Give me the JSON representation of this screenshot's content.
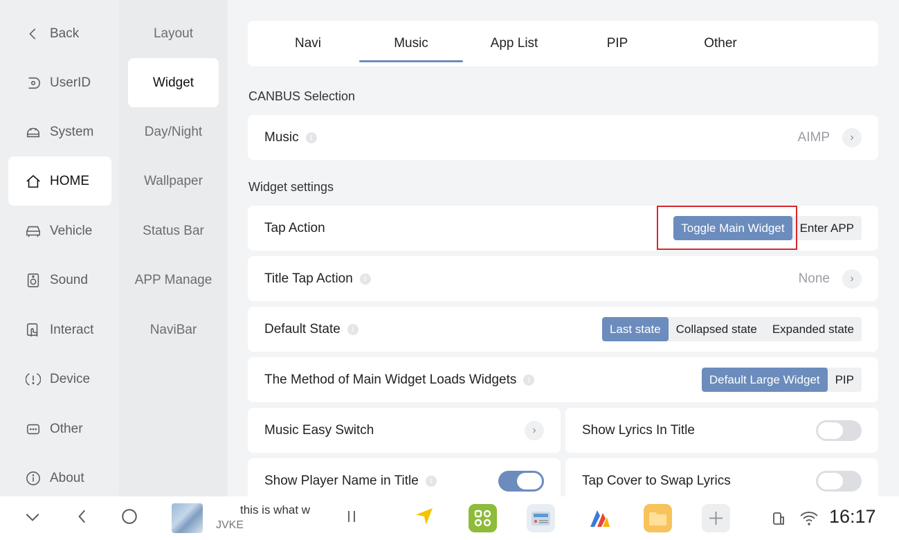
{
  "nav1": {
    "items": [
      {
        "label": "Back",
        "icon": "chevron-left-icon"
      },
      {
        "label": "UserID",
        "icon": "user-id-icon"
      },
      {
        "label": "System",
        "icon": "android-icon"
      },
      {
        "label": "HOME",
        "icon": "home-icon"
      },
      {
        "label": "Vehicle",
        "icon": "car-icon"
      },
      {
        "label": "Sound",
        "icon": "speaker-icon"
      },
      {
        "label": "Interact",
        "icon": "touch-icon"
      },
      {
        "label": "Device",
        "icon": "alert-icon"
      },
      {
        "label": "Other",
        "icon": "more-icon"
      },
      {
        "label": "About",
        "icon": "info-icon"
      }
    ],
    "active": "HOME"
  },
  "nav2": {
    "items": [
      "Layout",
      "Widget",
      "Day/Night",
      "Wallpaper",
      "Status Bar",
      "APP Manage",
      "NaviBar"
    ],
    "active": "Widget"
  },
  "tabs": {
    "items": [
      "Navi",
      "Music",
      "App List",
      "PIP",
      "Other"
    ],
    "active": "Music"
  },
  "canbus": {
    "title": "CANBUS Selection",
    "music_label": "Music",
    "music_value": "AIMP"
  },
  "widget_settings": {
    "title": "Widget settings",
    "tap_action": {
      "label": "Tap Action",
      "options": [
        "Toggle Main Widget",
        "Enter APP"
      ],
      "selected": "Toggle Main Widget"
    },
    "title_tap_action": {
      "label": "Title Tap Action",
      "value": "None"
    },
    "default_state": {
      "label": "Default State",
      "options": [
        "Last state",
        "Collapsed state",
        "Expanded state"
      ],
      "selected": "Last state"
    },
    "load_method": {
      "label": "The Method of Main Widget Loads Widgets",
      "options": [
        "Default Large Widget",
        "PIP"
      ],
      "selected": "Default Large Widget"
    },
    "music_easy_switch": {
      "label": "Music Easy Switch"
    },
    "show_lyrics_in_title": {
      "label": "Show Lyrics In Title",
      "on": false
    },
    "show_player_name": {
      "label": "Show Player Name in Title",
      "on": true
    },
    "tap_cover_swap": {
      "label": "Tap Cover to Swap Lyrics",
      "on": false
    }
  },
  "bottombar": {
    "song": "this is what w",
    "artist": "JVKE",
    "time": "16:17",
    "accent": "#6b8cbc"
  }
}
